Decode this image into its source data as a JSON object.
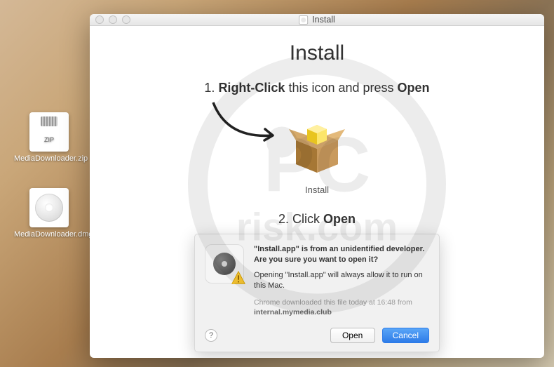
{
  "desktop": {
    "files": [
      {
        "name": "MediaDownloader.zip",
        "type": "zip"
      },
      {
        "name": "MediaDownloader.dmg",
        "type": "dmg"
      }
    ]
  },
  "window": {
    "title": "Install",
    "heading": "Install",
    "step1_prefix": "1. ",
    "step1_bold1": "Right-Click",
    "step1_mid": " this icon and press ",
    "step1_bold2": "Open",
    "pkg_label": "Install",
    "step2_prefix": "2. Click ",
    "step2_bold": "Open"
  },
  "dialog": {
    "title": "\"Install.app\" is from an unidentified developer. Are you sure you want to open it?",
    "subtitle": "Opening \"Install.app\" will always allow it to run on this Mac.",
    "meta": "Chrome downloaded this file today at 16:48 from",
    "source": "internal.mymedia.club",
    "help": "?",
    "open": "Open",
    "cancel": "Cancel"
  },
  "watermark": {
    "line1": "PC",
    "line2": "risk.com"
  }
}
